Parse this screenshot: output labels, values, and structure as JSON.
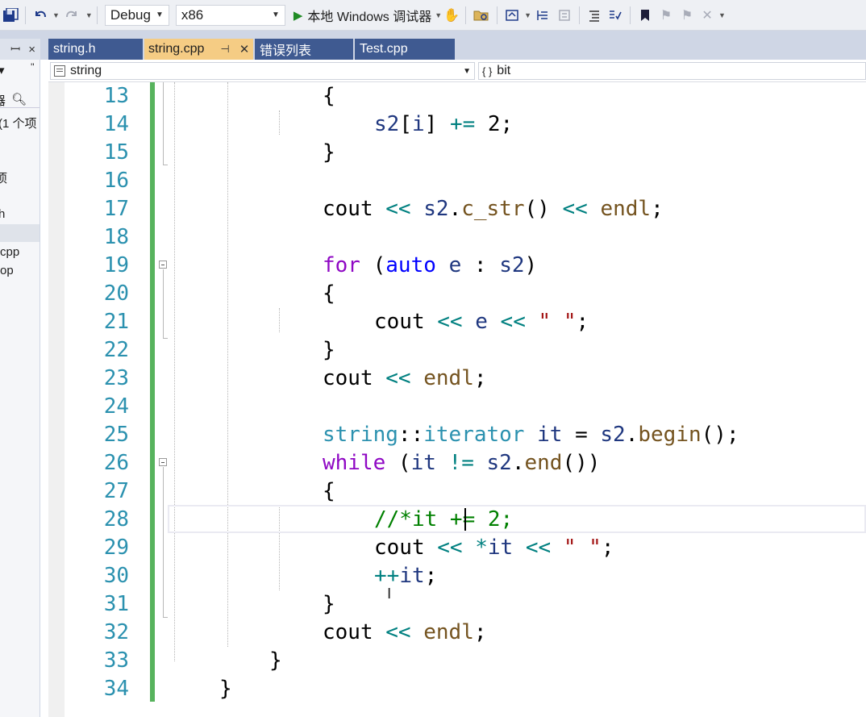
{
  "toolbar": {
    "config": "Debug",
    "platform": "x86",
    "run_label": "本地 Windows 调试器",
    "icons": [
      "save-all-icon",
      "undo-icon",
      "redo-icon",
      "start-debug-icon",
      "attach-icon",
      "open-folder-icon",
      "home-icon",
      "step-icon",
      "collapse-icon",
      "outline-icon",
      "comment-icon",
      "bookmark-icon",
      "prev-bookmark-icon",
      "next-bookmark-icon",
      "clear-bookmark-icon"
    ]
  },
  "tabs": [
    {
      "label": "string.h",
      "active": false
    },
    {
      "label": "string.cpp",
      "active": true
    },
    {
      "label": "错误列表",
      "active": false
    },
    {
      "label": "Test.cpp",
      "active": false
    }
  ],
  "left_panel": {
    "header_pin": "ꟷ",
    "header_close": "×",
    "rows": [
      "器",
      "(1 个项",
      "项",
      "h",
      "cpp",
      "op"
    ]
  },
  "navbar": {
    "scope": "string",
    "member": "bit"
  },
  "editor": {
    "line_numbers": [
      "13",
      "14",
      "15",
      "16",
      "17",
      "18",
      "19",
      "20",
      "21",
      "22",
      "23",
      "24",
      "25",
      "26",
      "27",
      "28",
      "29",
      "30",
      "31",
      "32",
      "33",
      "34"
    ],
    "lines": [
      [
        {
          "t": "{",
          "c": "pl"
        }
      ],
      [
        {
          "t": "s2",
          "c": "va"
        },
        {
          "t": "[",
          "c": "pl"
        },
        {
          "t": "i",
          "c": "va"
        },
        {
          "t": "] ",
          "c": "pl"
        },
        {
          "t": "+=",
          "c": "op"
        },
        {
          "t": " 2;",
          "c": "pl"
        }
      ],
      [
        {
          "t": "}",
          "c": "pl"
        }
      ],
      [],
      [
        {
          "t": "cout",
          "c": "pl"
        },
        {
          "t": " << ",
          "c": "op"
        },
        {
          "t": "s2",
          "c": "va"
        },
        {
          "t": ".",
          "c": "pl"
        },
        {
          "t": "c_str",
          "c": "fn"
        },
        {
          "t": "()",
          "c": "pl"
        },
        {
          "t": " << ",
          "c": "op"
        },
        {
          "t": "endl",
          "c": "fn"
        },
        {
          "t": ";",
          "c": "pl"
        }
      ],
      [],
      [
        {
          "t": "for",
          "c": "k"
        },
        {
          "t": " (",
          "c": "pl"
        },
        {
          "t": "auto",
          "c": "kt"
        },
        {
          "t": " ",
          "c": "pl"
        },
        {
          "t": "e",
          "c": "va"
        },
        {
          "t": " : ",
          "c": "pl"
        },
        {
          "t": "s2",
          "c": "va"
        },
        {
          "t": ")",
          "c": "pl"
        }
      ],
      [
        {
          "t": "{",
          "c": "pl"
        }
      ],
      [
        {
          "t": "cout",
          "c": "pl"
        },
        {
          "t": " << ",
          "c": "op"
        },
        {
          "t": "e",
          "c": "va"
        },
        {
          "t": " << ",
          "c": "op"
        },
        {
          "t": "\" \"",
          "c": "st"
        },
        {
          "t": ";",
          "c": "pl"
        }
      ],
      [
        {
          "t": "}",
          "c": "pl"
        }
      ],
      [
        {
          "t": "cout",
          "c": "pl"
        },
        {
          "t": " << ",
          "c": "op"
        },
        {
          "t": "endl",
          "c": "fn"
        },
        {
          "t": ";",
          "c": "pl"
        }
      ],
      [],
      [
        {
          "t": "string",
          "c": "ty"
        },
        {
          "t": "::",
          "c": "pl"
        },
        {
          "t": "iterator",
          "c": "ty"
        },
        {
          "t": " ",
          "c": "pl"
        },
        {
          "t": "it",
          "c": "va"
        },
        {
          "t": " = ",
          "c": "pl"
        },
        {
          "t": "s2",
          "c": "va"
        },
        {
          "t": ".",
          "c": "pl"
        },
        {
          "t": "begin",
          "c": "fn"
        },
        {
          "t": "();",
          "c": "pl"
        }
      ],
      [
        {
          "t": "while",
          "c": "k"
        },
        {
          "t": " (",
          "c": "pl"
        },
        {
          "t": "it",
          "c": "va"
        },
        {
          "t": " != ",
          "c": "op"
        },
        {
          "t": "s2",
          "c": "va"
        },
        {
          "t": ".",
          "c": "pl"
        },
        {
          "t": "end",
          "c": "fn"
        },
        {
          "t": "())",
          "c": "pl"
        }
      ],
      [
        {
          "t": "{",
          "c": "pl"
        }
      ],
      [
        {
          "t": "//*it += 2;",
          "c": "cm"
        }
      ],
      [
        {
          "t": "cout",
          "c": "pl"
        },
        {
          "t": " << ",
          "c": "op"
        },
        {
          "t": "*",
          "c": "op"
        },
        {
          "t": "it",
          "c": "va"
        },
        {
          "t": " << ",
          "c": "op"
        },
        {
          "t": "\" \"",
          "c": "st"
        },
        {
          "t": ";",
          "c": "pl"
        }
      ],
      [
        {
          "t": "++",
          "c": "op"
        },
        {
          "t": "it",
          "c": "va"
        },
        {
          "t": ";",
          "c": "pl"
        }
      ],
      [
        {
          "t": "}",
          "c": "pl"
        }
      ],
      [
        {
          "t": "cout",
          "c": "pl"
        },
        {
          "t": " << ",
          "c": "op"
        },
        {
          "t": "endl",
          "c": "fn"
        },
        {
          "t": ";",
          "c": "pl"
        }
      ],
      [
        {
          "t": "}",
          "c": "pl"
        }
      ],
      [
        {
          "t": "}",
          "c": "pl"
        }
      ]
    ],
    "current_line": "28"
  }
}
